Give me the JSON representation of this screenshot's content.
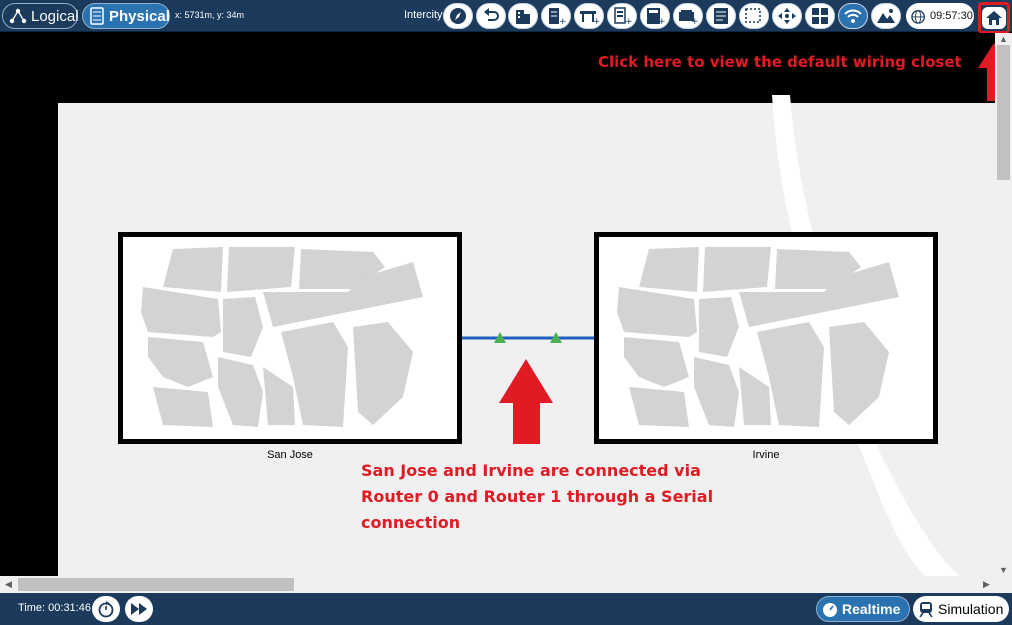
{
  "toolbar": {
    "logical_label": "Logical",
    "physical_label": "Physical",
    "coordinates": "x: 5731m, y: 34m",
    "location": "Intercity",
    "clock": "09:57:30",
    "icons": [
      "navigation-icon",
      "back-icon",
      "building-icon",
      "new-rack-icon",
      "new-table-icon",
      "new-rack-2-icon",
      "new-closet-icon",
      "new-device-icon",
      "notes-icon",
      "select-icon",
      "move-icon",
      "grid-icon",
      "wireless-icon",
      "background-image-icon",
      "globe-clock-icon",
      "home-icon"
    ]
  },
  "map": {
    "cities": [
      {
        "name": "San Jose"
      },
      {
        "name": "Irvine"
      }
    ],
    "link_type": "serial"
  },
  "annotations": {
    "home_hint": "Click here to view the default wiring closet",
    "serial_hint_line1": "San Jose and Irvine are connected via",
    "serial_hint_line2": "Router 0 and Router 1 through a Serial",
    "serial_hint_line3": "connection"
  },
  "bottombar": {
    "time": "Time: 00:31:46",
    "realtime_label": "Realtime",
    "simulation_label": "Simulation"
  },
  "colors": {
    "toolbar_bg": "#1b3a5c",
    "active_tab": "#2a72b0",
    "annotation_red": "#e01b24",
    "link_blue": "#1f5fbf",
    "link_marker_green": "#4caf50",
    "city_fill": "#d3d3d3"
  }
}
